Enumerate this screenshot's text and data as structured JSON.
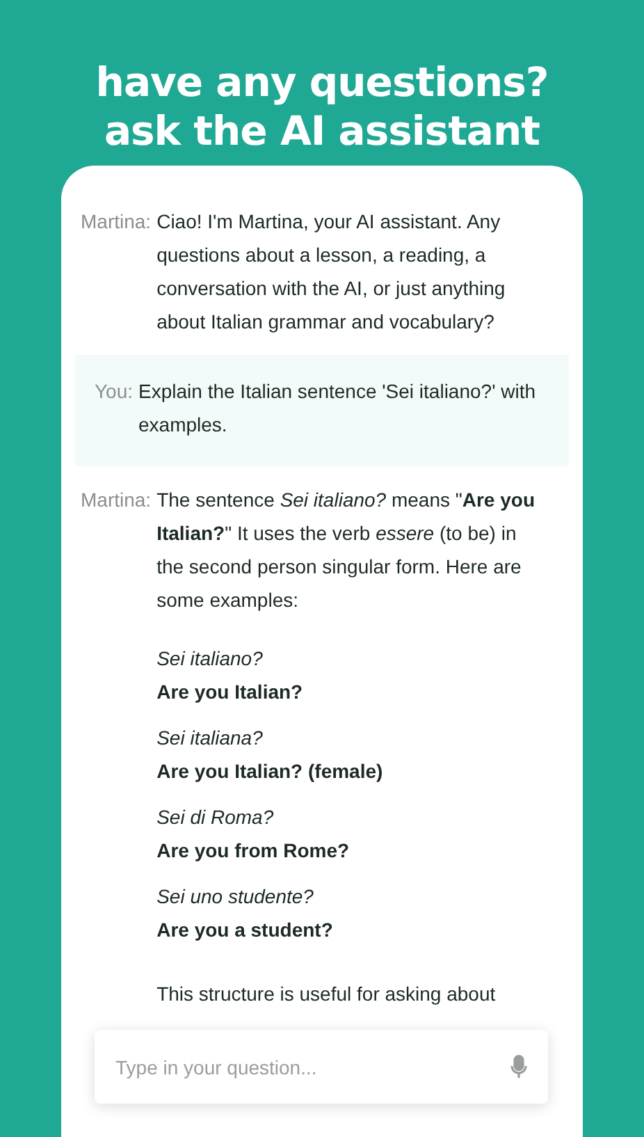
{
  "headline": [
    "have any questions?",
    "ask the AI assistant"
  ],
  "messages": [
    {
      "kind": "assistant",
      "speaker": "Martina:",
      "blocks": [
        {
          "kind": "paragraph",
          "text": "Ciao! I'm Martina, your AI assistant. Any questions about a lesson, a reading, a conversation with the AI, or just anything about Italian grammar and vocabulary?"
        }
      ]
    },
    {
      "kind": "user",
      "speaker": "You:",
      "blocks": [
        {
          "kind": "paragraph",
          "text": "Explain the Italian sentence 'Sei italiano?' with examples."
        }
      ]
    },
    {
      "kind": "assistant",
      "speaker": "Martina:",
      "blocks": [
        {
          "kind": "paragraph",
          "text": "The sentence *Sei italiano?* means \"**Are you Italian?**\" It uses the verb *essere* (to be) in the second person singular form. Here are some examples:"
        },
        {
          "kind": "example",
          "phrase": "Sei italiano?",
          "translation": "Are you Italian?"
        },
        {
          "kind": "example",
          "phrase": "Sei italiana?",
          "translation": "Are you Italian? (female)"
        },
        {
          "kind": "example",
          "phrase": "Sei di Roma?",
          "translation": "Are you from Rome?"
        },
        {
          "kind": "example",
          "phrase": "Sei uno studente?",
          "translation": "Are you a student?"
        },
        {
          "kind": "paragraph",
          "text": "This structure is useful for asking about"
        }
      ]
    }
  ],
  "input": {
    "placeholder": "Type in your question..."
  }
}
